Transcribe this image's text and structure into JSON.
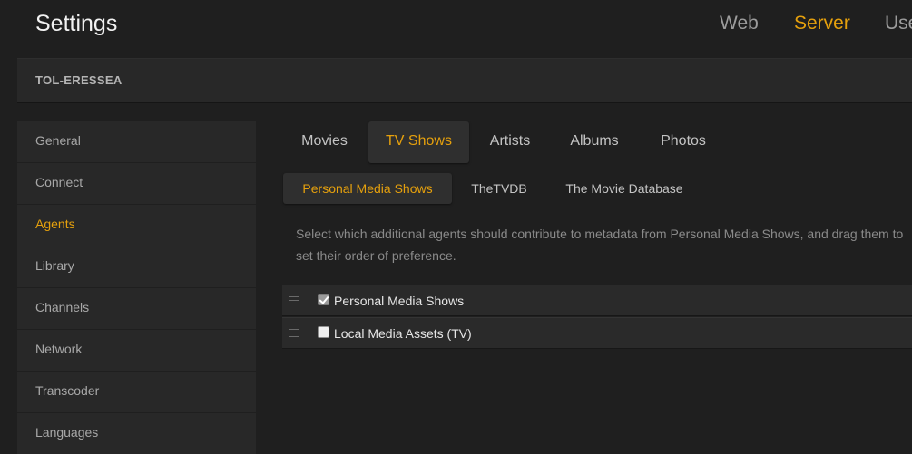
{
  "header": {
    "title": "Settings",
    "nav": [
      {
        "label": "Web",
        "active": false
      },
      {
        "label": "Server",
        "active": true
      },
      {
        "label": "Use",
        "active": false
      }
    ]
  },
  "server": {
    "name": "TOL-ERESSEA"
  },
  "sidebar": {
    "items": [
      {
        "label": "General"
      },
      {
        "label": "Connect"
      },
      {
        "label": "Agents",
        "active": true
      },
      {
        "label": "Library"
      },
      {
        "label": "Channels"
      },
      {
        "label": "Network"
      },
      {
        "label": "Transcoder"
      },
      {
        "label": "Languages"
      }
    ]
  },
  "tabs": [
    {
      "label": "Movies"
    },
    {
      "label": "TV Shows",
      "active": true
    },
    {
      "label": "Artists"
    },
    {
      "label": "Albums"
    },
    {
      "label": "Photos"
    }
  ],
  "subtabs": [
    {
      "label": "Personal Media Shows",
      "active": true
    },
    {
      "label": "TheTVDB"
    },
    {
      "label": "The Movie Database"
    }
  ],
  "description": "Select which additional agents should contribute to metadata from Personal Media Shows, and drag them to set their order of preference.",
  "agents": [
    {
      "name": "Personal Media Shows",
      "checked": true
    },
    {
      "name": "Local Media Assets (TV)",
      "checked": false
    }
  ],
  "colors": {
    "accent": "#e5a00d",
    "background": "#1f1f1f",
    "panel": "#282828"
  }
}
